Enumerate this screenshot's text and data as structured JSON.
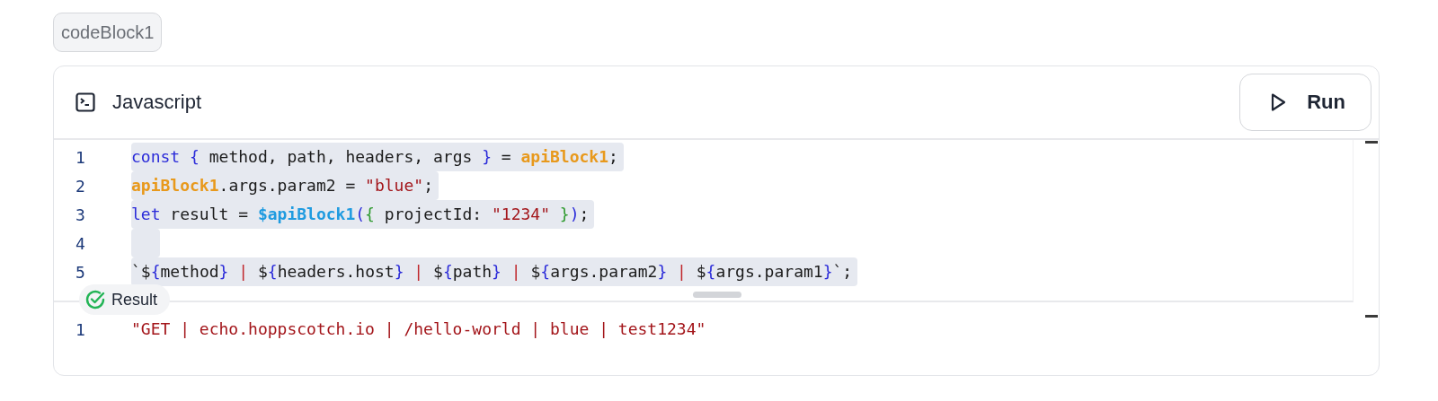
{
  "block_name": "codeBlock1",
  "editor": {
    "language": "Javascript",
    "run_button": "Run",
    "lines": [
      {
        "number": "1",
        "highlighted": true,
        "tokens": [
          {
            "kind": "keyword",
            "text": "const"
          },
          {
            "kind": "brace",
            "text": " {"
          },
          {
            "kind": "plain",
            "text": " method, path, headers, args "
          },
          {
            "kind": "brace",
            "text": "}"
          },
          {
            "kind": "plain",
            "text": " = "
          },
          {
            "kind": "variable",
            "text": "apiBlock1"
          },
          {
            "kind": "plain",
            "text": ";"
          }
        ]
      },
      {
        "number": "2",
        "highlighted": true,
        "tokens": [
          {
            "kind": "variable",
            "text": "apiBlock1"
          },
          {
            "kind": "plain",
            "text": ".args.param2 = "
          },
          {
            "kind": "string",
            "text": "\"blue\""
          },
          {
            "kind": "plain",
            "text": ";"
          }
        ]
      },
      {
        "number": "3",
        "highlighted": true,
        "tokens": [
          {
            "kind": "keyword",
            "text": "let"
          },
          {
            "kind": "plain",
            "text": " result = "
          },
          {
            "kind": "function",
            "text": "$apiBlock1"
          },
          {
            "kind": "brace",
            "text": "("
          },
          {
            "kind": "inner",
            "text": "{"
          },
          {
            "kind": "plain",
            "text": " projectId: "
          },
          {
            "kind": "string",
            "text": "\"1234\""
          },
          {
            "kind": "inner",
            "text": " }"
          },
          {
            "kind": "brace",
            "text": ")"
          },
          {
            "kind": "plain",
            "text": ";"
          }
        ]
      },
      {
        "number": "4",
        "highlighted": true
      },
      {
        "number": "5",
        "highlighted": true,
        "tokens": [
          {
            "kind": "plain",
            "text": "`$"
          },
          {
            "kind": "brace",
            "text": "{"
          },
          {
            "kind": "plain",
            "text": "method"
          },
          {
            "kind": "brace",
            "text": "}"
          },
          {
            "kind": "operator",
            "text": " |"
          },
          {
            "kind": "plain",
            "text": " $"
          },
          {
            "kind": "brace",
            "text": "{"
          },
          {
            "kind": "plain",
            "text": "headers.host"
          },
          {
            "kind": "brace",
            "text": "}"
          },
          {
            "kind": "operator",
            "text": " |"
          },
          {
            "kind": "plain",
            "text": " $"
          },
          {
            "kind": "brace",
            "text": "{"
          },
          {
            "kind": "plain",
            "text": "path"
          },
          {
            "kind": "brace",
            "text": "}"
          },
          {
            "kind": "operator",
            "text": " |"
          },
          {
            "kind": "plain",
            "text": " $"
          },
          {
            "kind": "brace",
            "text": "{"
          },
          {
            "kind": "plain",
            "text": "args.param2"
          },
          {
            "kind": "brace",
            "text": "}"
          },
          {
            "kind": "operator",
            "text": " |"
          },
          {
            "kind": "plain",
            "text": " $"
          },
          {
            "kind": "brace",
            "text": "{"
          },
          {
            "kind": "plain",
            "text": "args.param1"
          },
          {
            "kind": "brace",
            "text": "}"
          },
          {
            "kind": "plain",
            "text": "`;"
          }
        ]
      }
    ]
  },
  "result": {
    "label": "Result",
    "lines": [
      {
        "number": "1",
        "text": "\"GET | echo.hoppscotch.io | /hello-world | blue | test1234\""
      }
    ]
  }
}
